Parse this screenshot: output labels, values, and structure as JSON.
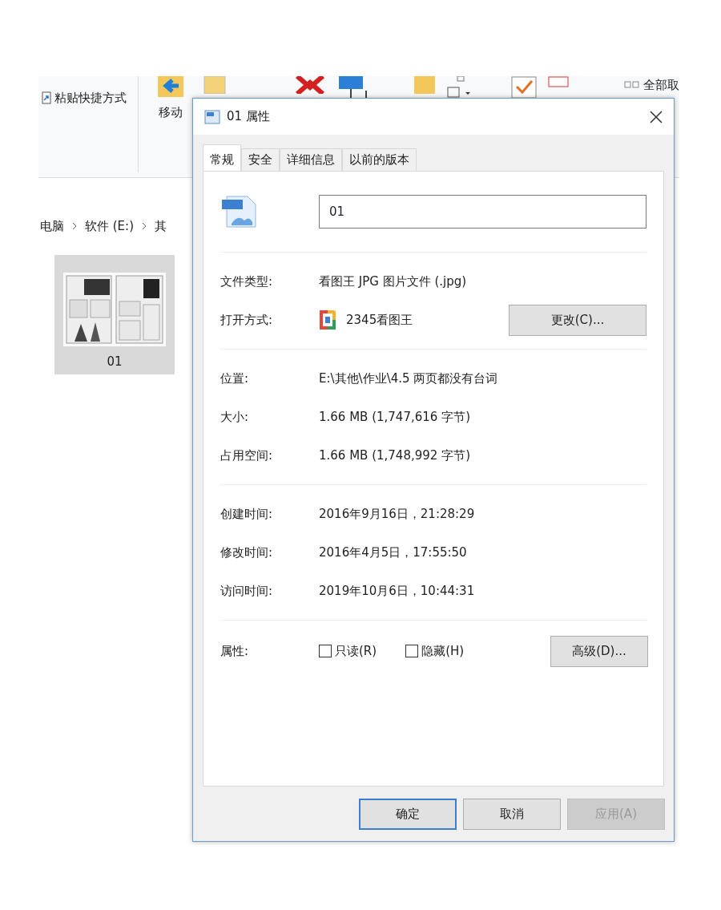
{
  "explorer": {
    "ribbon": {
      "paste_shortcut": "粘贴快捷方式",
      "move_to": "移动",
      "select_all": "全部取"
    },
    "breadcrumb": [
      "电脑",
      "软件 (E:)",
      "其"
    ],
    "file": {
      "name": "01",
      "selected": true
    }
  },
  "dialog": {
    "title": "01 属性",
    "tabs": [
      {
        "label": "常规",
        "selected": true
      },
      {
        "label": "安全",
        "selected": false
      },
      {
        "label": "详细信息",
        "selected": false
      },
      {
        "label": "以前的版本",
        "selected": false
      }
    ],
    "file_name": "01",
    "sections": [
      [
        {
          "kind": "text",
          "label": "文件类型:",
          "value": "看图王 JPG 图片文件 (.jpg)"
        },
        {
          "kind": "app",
          "label": "打开方式:",
          "value": "2345看图王",
          "button": "更改(C)..."
        }
      ],
      [
        {
          "kind": "text",
          "label": "位置:",
          "value": "E:\\其他\\作业\\4.5  两页都没有台词"
        },
        {
          "kind": "text",
          "label": "大小:",
          "value": "1.66 MB (1,747,616 字节)"
        },
        {
          "kind": "text",
          "label": "占用空间:",
          "value": "1.66 MB (1,748,992 字节)"
        }
      ],
      [
        {
          "kind": "text",
          "label": "创建时间:",
          "value": "2016年9月16日，21:28:29"
        },
        {
          "kind": "text",
          "label": "修改时间:",
          "value": "2016年4月5日，17:55:50"
        },
        {
          "kind": "text",
          "label": "访问时间:",
          "value": "2019年10月6日，10:44:31"
        }
      ]
    ],
    "attributes": {
      "label": "属性:",
      "options": [
        {
          "label": "只读(R)",
          "checked": false
        },
        {
          "label": "隐藏(H)",
          "checked": false
        }
      ],
      "advanced": "高级(D)..."
    },
    "buttons": [
      {
        "label": "确定",
        "default": true,
        "disabled": false
      },
      {
        "label": "取消",
        "default": false,
        "disabled": false
      },
      {
        "label": "应用(A)",
        "default": false,
        "disabled": true
      }
    ]
  }
}
